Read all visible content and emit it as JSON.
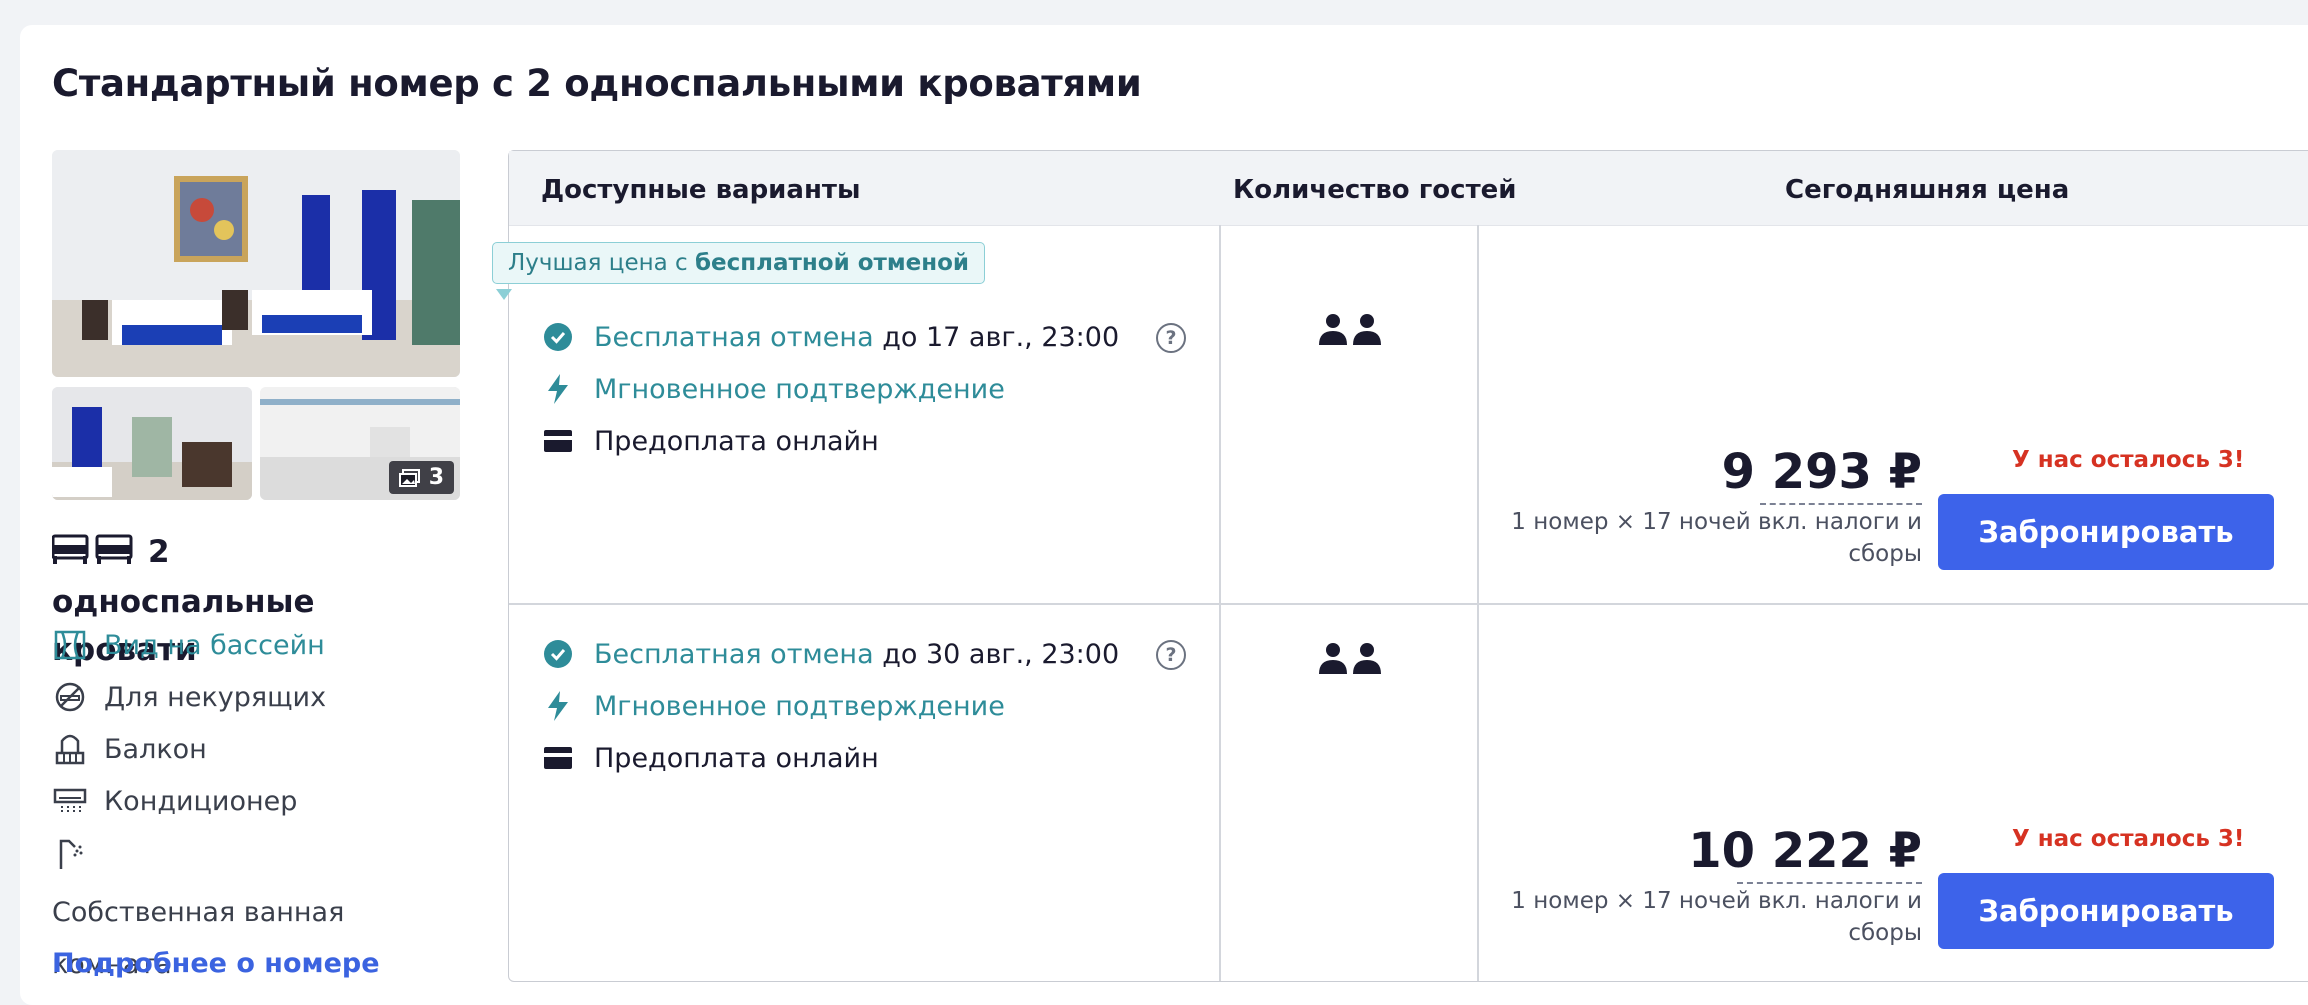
{
  "room": {
    "title": "Стандартный номер с 2 односпальными кроватями",
    "photo_count": "3",
    "beds_label": "2 односпальные кровати",
    "amenities": [
      {
        "label": "Вид на бассейн",
        "icon": "window-view-icon"
      },
      {
        "label": "Для некурящих",
        "icon": "no-smoking-icon"
      },
      {
        "label": "Балкон",
        "icon": "balcony-icon"
      },
      {
        "label": "Кондиционер",
        "icon": "air-conditioner-icon"
      },
      {
        "label": "Собственная ванная комната",
        "icon": "shower-icon"
      }
    ],
    "more_link": "Подробнее о номере"
  },
  "table": {
    "headers": {
      "options": "Доступные варианты",
      "guests": "Количество гостей",
      "price": "Сегодняшняя цена"
    }
  },
  "badge": {
    "prefix": "Лучшая цена с ",
    "bold": "бесплатной отменой"
  },
  "offers": [
    {
      "cancel_label": "Бесплатная отмена",
      "cancel_until": "до 17 авг., 23:00",
      "instant": "Мгновенное подтверждение",
      "prepay": "Предоплата онлайн",
      "price": "9 293 ₽",
      "price_note_1": "1 номер × 17 ночей вкл. налоги и",
      "price_note_2": "сборы",
      "availability": "У нас осталось 3!",
      "book_label": "Забронировать"
    },
    {
      "cancel_label": "Бесплатная отмена",
      "cancel_until": "до 30 авг., 23:00",
      "instant": "Мгновенное подтверждение",
      "prepay": "Предоплата онлайн",
      "price": "10 222 ₽",
      "price_note_1": "1 номер × 17 ночей вкл. налоги и",
      "price_note_2": "сборы",
      "availability": "У нас осталось 3!",
      "book_label": "Забронировать"
    }
  ],
  "colors": {
    "accent_teal": "#2e8c99",
    "book_blue": "#3d63ea",
    "link_blue": "#3b63e0",
    "urgent_red": "#d63222"
  }
}
